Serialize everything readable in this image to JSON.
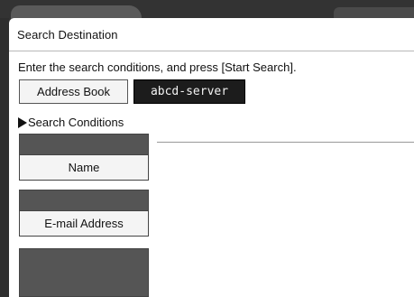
{
  "window": {
    "title": "Search Destination"
  },
  "instruction": "Enter the search conditions, and press [Start Search].",
  "sources": {
    "address_book_label": "Address Book",
    "server_label": "abcd-server",
    "selected": "abcd-server"
  },
  "search_conditions": {
    "heading": "Search Conditions",
    "fields": [
      {
        "label": "Name",
        "value": ""
      },
      {
        "label": "E-mail Address",
        "value": ""
      }
    ]
  },
  "colors": {
    "selected_button_bg": "#1c1c1c",
    "field_value_bg": "#555555",
    "screen_bg": "#ffffff"
  }
}
